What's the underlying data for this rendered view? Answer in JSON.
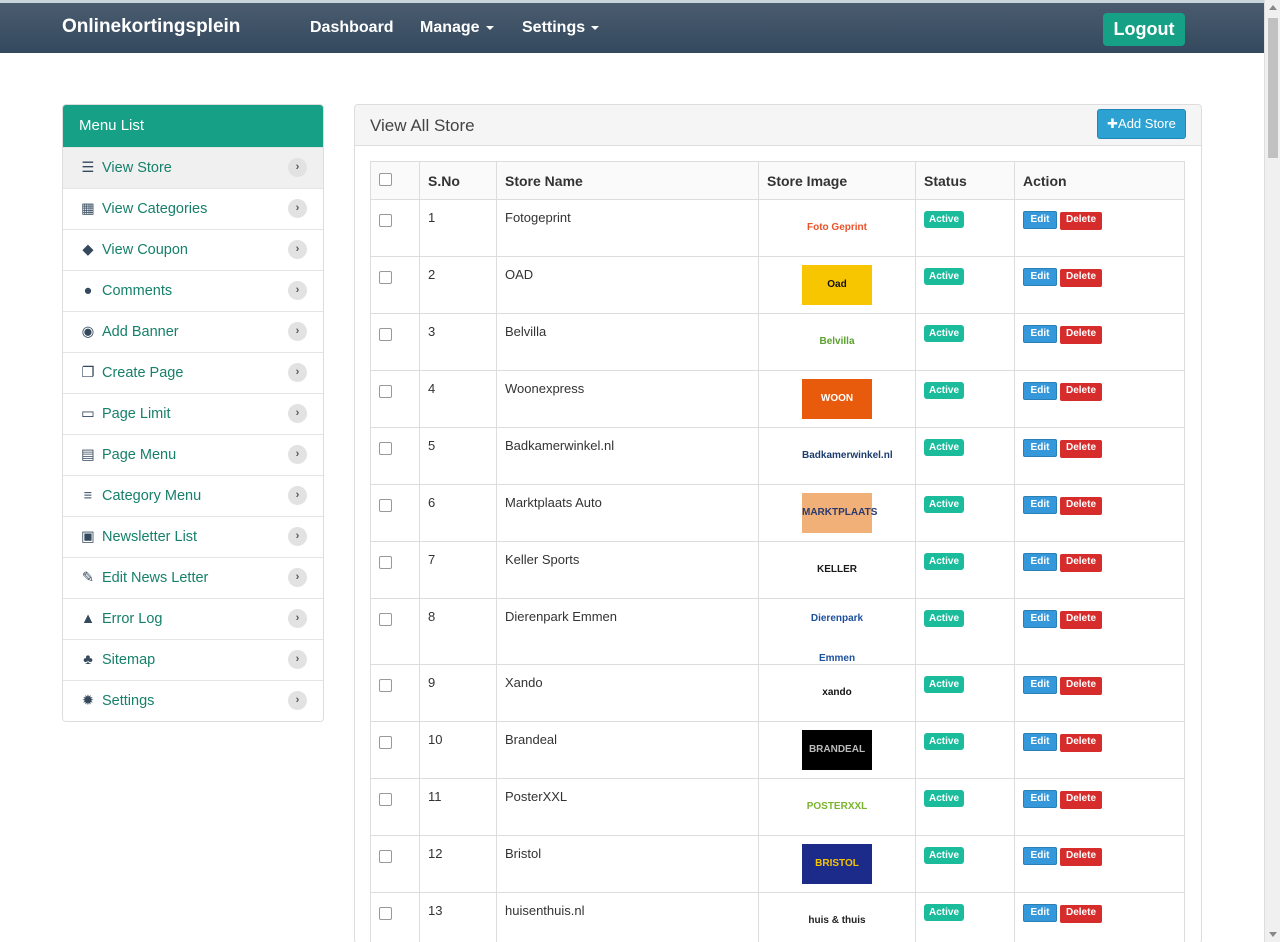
{
  "header": {
    "brand": "Onlinekortingsplein",
    "nav": [
      "Dashboard",
      "Manage",
      "Settings"
    ],
    "logout": "Logout"
  },
  "sidebar": {
    "title": "Menu List",
    "items": [
      {
        "label": "View Store",
        "icon": "list-icon"
      },
      {
        "label": "View Categories",
        "icon": "building-icon"
      },
      {
        "label": "View Coupon",
        "icon": "tags-icon"
      },
      {
        "label": "Comments",
        "icon": "comments-icon"
      },
      {
        "label": "Add Banner",
        "icon": "camera-icon"
      },
      {
        "label": "Create Page",
        "icon": "copy-icon"
      },
      {
        "label": "Page Limit",
        "icon": "credit-card-icon"
      },
      {
        "label": "Page Menu",
        "icon": "list-alt-icon"
      },
      {
        "label": "Category Menu",
        "icon": "th-list-icon"
      },
      {
        "label": "Newsletter List",
        "icon": "briefcase-icon"
      },
      {
        "label": "Edit News Letter",
        "icon": "edit-icon"
      },
      {
        "label": "Error Log",
        "icon": "warning-icon"
      },
      {
        "label": "Sitemap",
        "icon": "sitemap-icon"
      },
      {
        "label": "Settings",
        "icon": "gear-icon"
      }
    ]
  },
  "panel": {
    "title": "View All Store",
    "add_button": "Add Store",
    "columns": [
      "S.No",
      "Store Name",
      "Store Image",
      "Status",
      "Action"
    ],
    "status_label": "Active",
    "edit_label": "Edit",
    "delete_label": "Delete",
    "rows": [
      {
        "no": "1",
        "name": "Fotogeprint",
        "logo": "Foto Geprint",
        "logo_bg": "#ffffff",
        "logo_fg": "#e8532b"
      },
      {
        "no": "2",
        "name": "OAD",
        "logo": "Oad",
        "logo_bg": "#f7c600",
        "logo_fg": "#111111"
      },
      {
        "no": "3",
        "name": "Belvilla",
        "logo": "Belvilla",
        "logo_bg": "#ffffff",
        "logo_fg": "#5aa02c"
      },
      {
        "no": "4",
        "name": "Woonexpress",
        "logo": "WOON",
        "logo_bg": "#e85a0c",
        "logo_fg": "#ffffff"
      },
      {
        "no": "5",
        "name": "Badkamerwinkel.nl",
        "logo": "Badkamerwinkel.nl",
        "logo_bg": "#ffffff",
        "logo_fg": "#1d3d6e"
      },
      {
        "no": "6",
        "name": "Marktplaats Auto",
        "logo": "MARKTPLAATS",
        "logo_bg": "#f0b078",
        "logo_fg": "#2b3a6e"
      },
      {
        "no": "7",
        "name": "Keller Sports",
        "logo": "KELLER",
        "logo_bg": "#ffffff",
        "logo_fg": "#1a1a1a"
      },
      {
        "no": "8",
        "name": "Dierenpark Emmen",
        "logo": "Dierenpark Emmen",
        "logo_bg": "#ffffff",
        "logo_fg": "#1c4f9c"
      },
      {
        "no": "9",
        "name": "Xando",
        "logo": "xando",
        "logo_bg": "#ffffff",
        "logo_fg": "#111111"
      },
      {
        "no": "10",
        "name": "Brandeal",
        "logo": "BRANDEAL",
        "logo_bg": "#000000",
        "logo_fg": "#bbbbbb"
      },
      {
        "no": "11",
        "name": "PosterXXL",
        "logo": "POSTERXXL",
        "logo_bg": "#ffffff",
        "logo_fg": "#7bb32e"
      },
      {
        "no": "12",
        "name": "Bristol",
        "logo": "BRISTOL",
        "logo_bg": "#1c2a8a",
        "logo_fg": "#f5c400"
      },
      {
        "no": "13",
        "name": "huisenthuis.nl",
        "logo": "huis & thuis",
        "logo_bg": "#ffffff",
        "logo_fg": "#222222"
      }
    ]
  }
}
